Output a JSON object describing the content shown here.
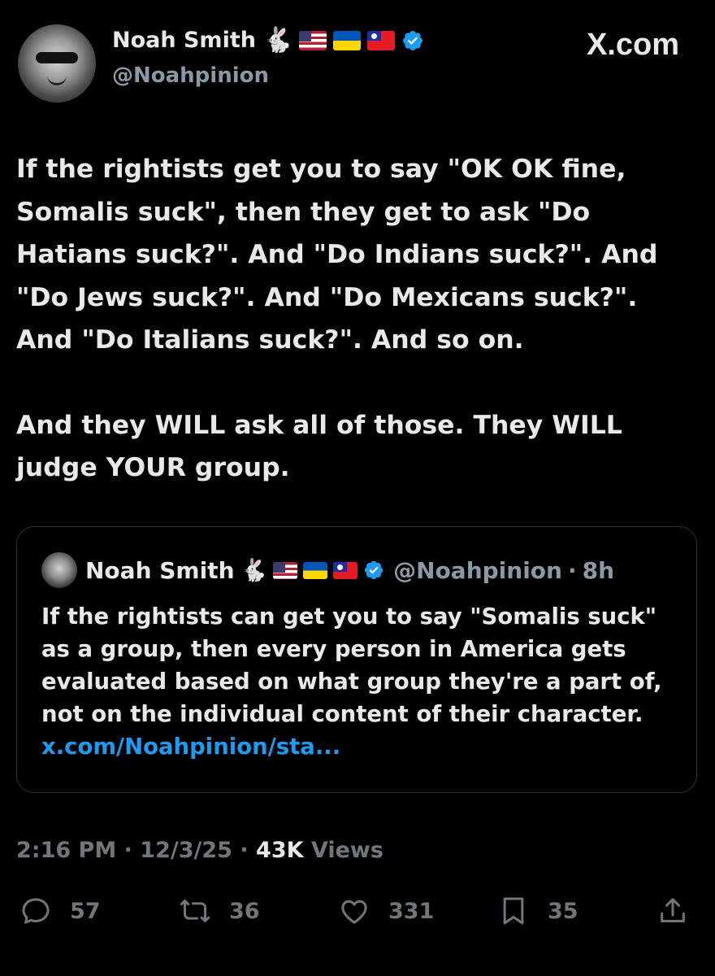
{
  "author": {
    "name": "Noah Smith",
    "name_emojis": [
      "rabbit",
      "flag-us",
      "flag-ukraine",
      "flag-taiwan"
    ],
    "verified": true,
    "handle": "@Noahpinion"
  },
  "site_mark": "X.com",
  "tweet": {
    "paragraphs": [
      "If the rightists get you to say \"OK OK fine, Somalis suck\", then they get to ask \"Do Hatians suck?\". And \"Do Indians suck?\". And \"Do Jews suck?\". And \"Do Mexicans suck?\". And \"Do Italians suck?\". And so on.",
      "And they WILL ask all of those. They WILL judge YOUR group."
    ]
  },
  "quote": {
    "name": "Noah Smith",
    "handle": "@Noahpinion",
    "separator": "·",
    "age": "8h",
    "text": "If the rightists can get you to say \"Somalis suck\" as a group, then every person in America gets evaluated based on what group they're a part of, not on the individual content of their character.",
    "link": "x.com/Noahpinion/sta..."
  },
  "timestamp": {
    "time": "2:16 PM",
    "date": "12/3/25",
    "views_count": "43K",
    "views_label": "Views"
  },
  "actions": {
    "replies": "57",
    "reposts": "36",
    "likes": "331",
    "bookmarks": "35"
  },
  "colors": {
    "background": "#000000",
    "text": "#e7e9ea",
    "muted": "#71767b",
    "link": "#1d9bf0",
    "verified": "#1d9bf0"
  }
}
